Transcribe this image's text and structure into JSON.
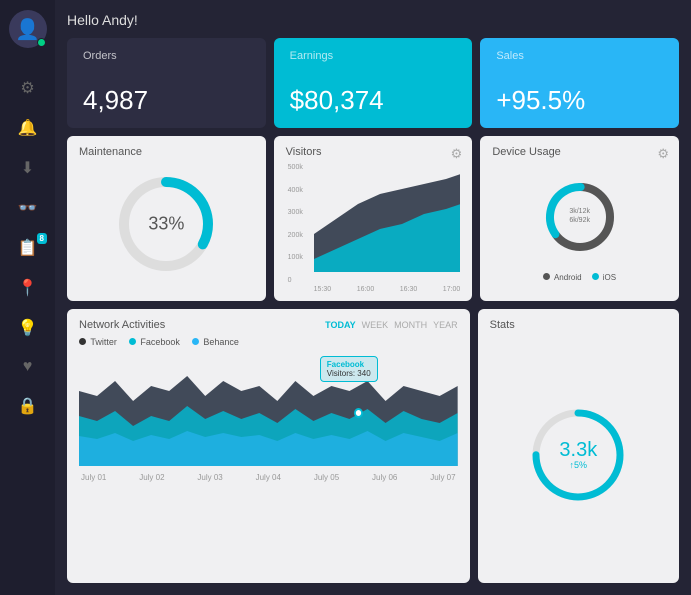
{
  "sidebar": {
    "avatar_icon": "👤",
    "items": [
      {
        "icon": "⚙",
        "name": "settings",
        "label": "Settings"
      },
      {
        "icon": "🔔",
        "name": "notifications",
        "label": "Notifications"
      },
      {
        "icon": "⬇",
        "name": "downloads",
        "label": "Downloads"
      },
      {
        "icon": "👓",
        "name": "view",
        "label": "View"
      },
      {
        "icon": "📋",
        "name": "reports",
        "label": "Reports",
        "badge": "8"
      },
      {
        "icon": "📍",
        "name": "location",
        "label": "Location"
      },
      {
        "icon": "💡",
        "name": "ideas",
        "label": "Ideas"
      },
      {
        "icon": "❤",
        "name": "favorites",
        "label": "Favorites"
      },
      {
        "icon": "🔒",
        "name": "security",
        "label": "Security"
      }
    ]
  },
  "header": {
    "greeting": "Hello Andy!"
  },
  "stats": {
    "orders": {
      "label": "Orders",
      "value": "4,987"
    },
    "earnings": {
      "label": "Earnings",
      "value": "$80,374"
    },
    "sales": {
      "label": "Sales",
      "value": "+95.5%"
    }
  },
  "maintenance": {
    "title": "Maintenance",
    "value": "33%",
    "percent": 33,
    "color": "#00bcd4",
    "track_color": "#ddd"
  },
  "visitors": {
    "title": "Visitors",
    "yaxis": [
      "500k",
      "400k",
      "300k",
      "200k",
      "100k",
      "0"
    ],
    "xaxis": [
      "15:30",
      "16:00",
      "16:30",
      "17:00"
    ]
  },
  "device_usage": {
    "title": "Device Usage",
    "android_percent": 65,
    "ios_percent": 35,
    "center_line1": "3k/12k",
    "center_line2": "6k/92k",
    "android_color": "#444",
    "ios_color": "#00bcd4",
    "legend": [
      {
        "label": "Android",
        "color": "#555"
      },
      {
        "label": "iOS",
        "color": "#00bcd4"
      }
    ]
  },
  "network": {
    "title": "Network Activities",
    "tabs": [
      "TODAY",
      "WEEK",
      "MONTH",
      "YEAR"
    ],
    "active_tab": "TODAY",
    "legend": [
      {
        "label": "Twitter",
        "color": "#333"
      },
      {
        "label": "Facebook",
        "color": "#00bcd4"
      },
      {
        "label": "Behance",
        "color": "#29b6f6"
      }
    ],
    "tooltip": {
      "label": "Facebook",
      "sub": "Visitors: 340"
    },
    "xaxis": [
      "July 01",
      "July 02",
      "July 03",
      "July 04",
      "July 05",
      "July 06",
      "July 07"
    ]
  },
  "stats_widget": {
    "title": "Stats",
    "value": "3.3k",
    "change": "↑5%",
    "percent": 75,
    "color": "#00bcd4",
    "track_color": "#ddd"
  }
}
